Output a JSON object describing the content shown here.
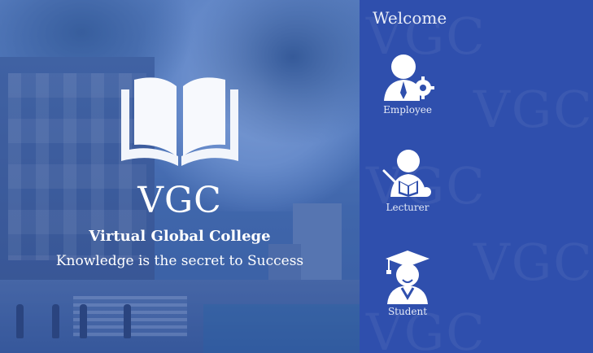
{
  "brand": {
    "short": "VGC",
    "name": "Virtual Global College",
    "tagline": "Knowledge is the secret to Success"
  },
  "side": {
    "welcome": "Welcome",
    "watermark": "VGC",
    "roles": [
      {
        "label": "Employee",
        "icon": "employee-icon"
      },
      {
        "label": "Lecturer",
        "icon": "lecturer-icon"
      },
      {
        "label": "Student",
        "icon": "student-icon"
      }
    ]
  },
  "colors": {
    "panel": "#2f4fad",
    "accent": "#ffffff"
  }
}
